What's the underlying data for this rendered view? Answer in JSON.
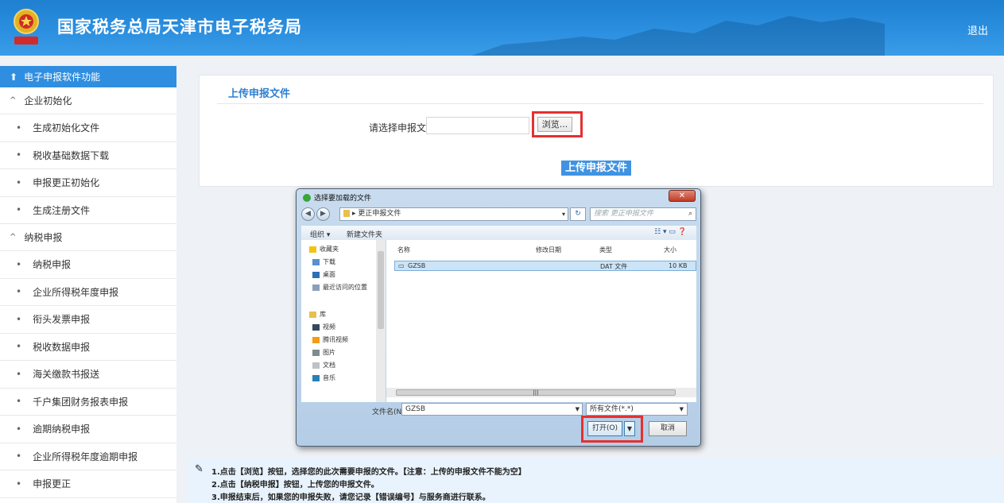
{
  "header": {
    "title": "国家税务总局天津市电子税务局",
    "logout": "退出"
  },
  "sidebar": {
    "head": "电子申报软件功能",
    "groups": [
      {
        "label": "企业初始化",
        "items": [
          "生成初始化文件",
          "税收基础数据下载",
          "申报更正初始化",
          "生成注册文件"
        ]
      },
      {
        "label": "纳税申报",
        "items": [
          "纳税申报",
          "企业所得税年度申报",
          "衔头发票申报",
          "税收数据申报",
          "海关缴款书报送",
          "千户集团财务报表申报",
          "逾期纳税申报",
          "企业所得税年度逾期申报",
          "申报更正"
        ]
      }
    ]
  },
  "main": {
    "title": "上传申报文件",
    "file_label": "请选择申报文件：",
    "browse": "浏览...",
    "upload": "上传申报文件"
  },
  "notes": [
    "1.点击【浏览】按钮，选择您的此次需要申报的文件。【注意：上传的申报文件不能为空】",
    "2.点击【纳税申报】按钮，上传您的申报文件。",
    "3.申报结束后，如果您的申报失败，请您记录【错误编号】与服务商进行联系。"
  ],
  "dialog": {
    "title": "选择要加载的文件",
    "path": "更正申报文件",
    "search_placeholder": "搜索 更正申报文件",
    "organize": "组织 ▾",
    "new_folder": "新建文件夹",
    "nav": {
      "favorites": "收藏夹",
      "downloads": "下载",
      "desktop": "桌面",
      "recent": "最近访问的位置",
      "libraries": "库",
      "videos": "视频",
      "tencent_video": "腾讯视频",
      "pictures": "图片",
      "documents": "文档",
      "music": "音乐"
    },
    "columns": {
      "name": "名称",
      "date": "修改日期",
      "type": "类型",
      "size": "大小"
    },
    "file": {
      "name": "GZSB",
      "type": "DAT 文件",
      "size": "10 KB"
    },
    "filename_label": "文件名(N):",
    "filename_value": "GZSB",
    "filetype": "所有文件(*.*)",
    "open": "打开(O)",
    "cancel": "取消"
  }
}
